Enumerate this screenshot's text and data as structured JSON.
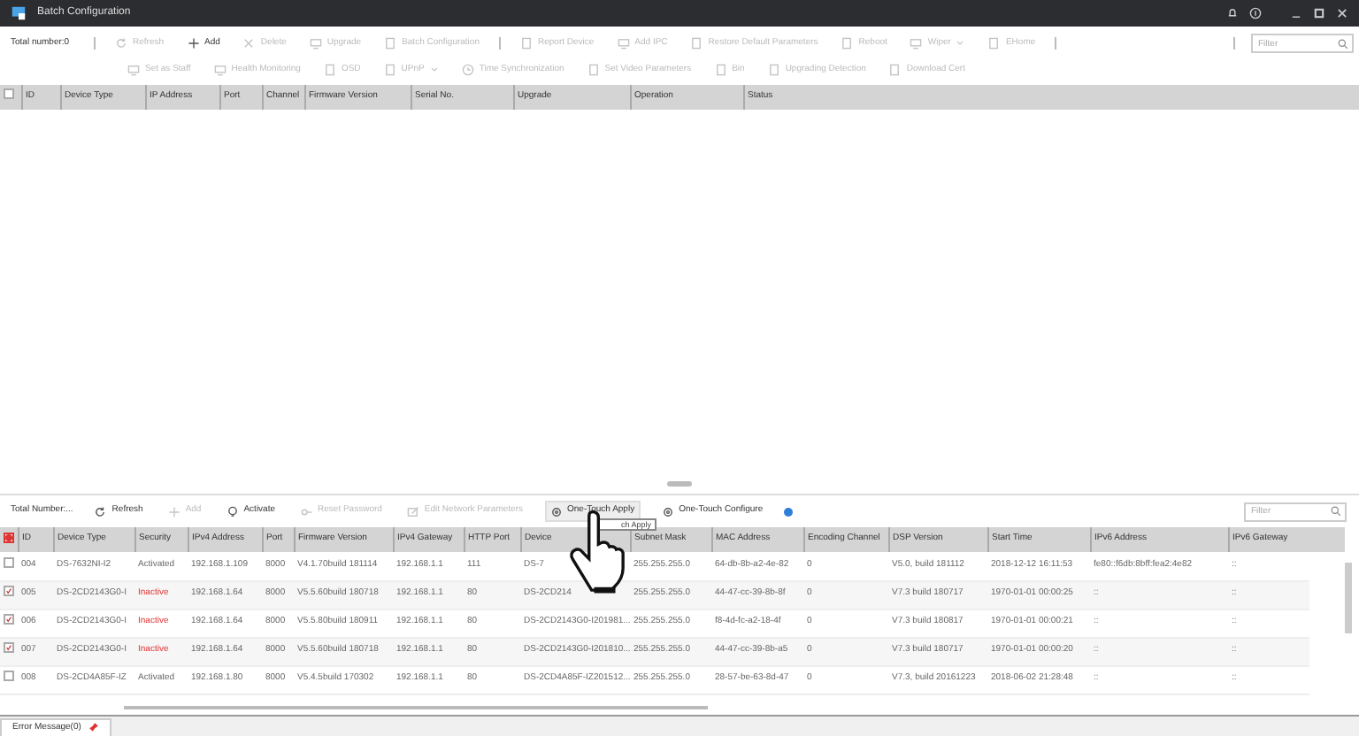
{
  "window": {
    "title": "Batch Configuration"
  },
  "top_panel": {
    "total": "Total number:0",
    "toolbar_rows": [
      [
        {
          "label": "Refresh",
          "disabled": true
        },
        {
          "label": "Add",
          "disabled": false
        },
        {
          "label": "Delete",
          "disabled": true
        },
        {
          "label": "Upgrade",
          "disabled": true
        },
        {
          "label": "Batch Configuration",
          "disabled": true
        },
        {
          "label": "Report Device",
          "disabled": true
        },
        {
          "label": "Add IPC",
          "disabled": true
        },
        {
          "label": "Restore Default Parameters",
          "disabled": true
        },
        {
          "label": "Reboot",
          "disabled": true
        },
        {
          "label": "Wiper",
          "disabled": true,
          "dropdown": true
        },
        {
          "label": "EHome",
          "disabled": true
        }
      ],
      [
        {
          "label": "Set as Staff",
          "disabled": true
        },
        {
          "label": "Health Monitoring",
          "disabled": true
        },
        {
          "label": "OSD",
          "disabled": true
        },
        {
          "label": "UPnP",
          "disabled": true,
          "dropdown": true
        },
        {
          "label": "Time Synchronization",
          "disabled": true
        },
        {
          "label": "Set Video Parameters",
          "disabled": true
        },
        {
          "label": "Bin",
          "disabled": true
        },
        {
          "label": "Upgrading Detection",
          "disabled": true
        },
        {
          "label": "Download Cert",
          "disabled": true
        }
      ]
    ],
    "filter": {
      "placeholder": "Filter"
    },
    "header_checkbox": {
      "checked": false
    },
    "columns": [
      "ID",
      "Device Type",
      "IP Address",
      "Port",
      "Channel",
      "Firmware Version",
      "Serial No.",
      "Upgrade",
      "Operation",
      "Status"
    ]
  },
  "bottom_panel": {
    "total": "Total Number:...",
    "toolbar": [
      {
        "label": "Refresh",
        "disabled": false,
        "hovered": false
      },
      {
        "label": "Add",
        "disabled": true,
        "hovered": false
      },
      {
        "label": "Activate",
        "disabled": false,
        "hovered": false
      },
      {
        "label": "Reset Password",
        "disabled": true,
        "hovered": false
      },
      {
        "label": "Edit Network Parameters",
        "disabled": true,
        "hovered": false
      },
      {
        "label": "One-Touch Apply",
        "disabled": false,
        "hovered": true
      },
      {
        "label": "One-Touch Configure",
        "disabled": false,
        "hovered": false
      }
    ],
    "tooltip": "ch Apply",
    "filter": {
      "placeholder": "Filter"
    },
    "header_checkbox": {
      "partial": true
    },
    "columns": [
      "ID",
      "Device Type",
      "Security",
      "IPv4 Address",
      "Port",
      "Firmware Version",
      "IPv4 Gateway",
      "HTTP Port",
      "Device",
      "Subnet Mask",
      "MAC Address",
      "Encoding Channel",
      "DSP Version",
      "Start Time",
      "IPv6 Address",
      "IPv6 Gateway"
    ],
    "rows": [
      {
        "checked": false,
        "security_alert": false,
        "cells": [
          "004",
          "DS-7632NI-I2",
          "Activated",
          "192.168.1.109",
          "8000",
          "V4.1.70build 181114",
          "192.168.1.1",
          "111",
          "DS-7",
          "255.255.255.0",
          "64-db-8b-a2-4e-82",
          "0",
          "V5.0, build 181112",
          "2018-12-12 16:11:53",
          "fe80::f6db:8bff:fea2:4e82",
          "::"
        ]
      },
      {
        "checked": true,
        "security_alert": true,
        "cells": [
          "005",
          "DS-2CD2143G0-I",
          "Inactive",
          "192.168.1.64",
          "8000",
          "V5.5.60build 180718",
          "192.168.1.1",
          "80",
          "DS-2CD214",
          "255.255.255.0",
          "44-47-cc-39-8b-8f",
          "0",
          "V7.3 build 180717",
          "1970-01-01 00:00:25",
          "::",
          "::"
        ]
      },
      {
        "checked": true,
        "security_alert": true,
        "cells": [
          "006",
          "DS-2CD2143G0-I",
          "Inactive",
          "192.168.1.64",
          "8000",
          "V5.5.80build 180911",
          "192.168.1.1",
          "80",
          "DS-2CD2143G0-I201981...",
          "255.255.255.0",
          "f8-4d-fc-a2-18-4f",
          "0",
          "V7.3 build 180817",
          "1970-01-01 00:00:21",
          "::",
          "::"
        ]
      },
      {
        "checked": true,
        "security_alert": true,
        "cells": [
          "007",
          "DS-2CD2143G0-I",
          "Inactive",
          "192.168.1.64",
          "8000",
          "V5.5.60build 180718",
          "192.168.1.1",
          "80",
          "DS-2CD2143G0-I201810...",
          "255.255.255.0",
          "44-47-cc-39-8b-a5",
          "0",
          "V7.3 build 180717",
          "1970-01-01 00:00:20",
          "::",
          "::"
        ]
      },
      {
        "checked": false,
        "security_alert": false,
        "cells": [
          "008",
          "DS-2CD4A85F-IZ",
          "Activated",
          "192.168.1.80",
          "8000",
          "V5.4.5build 170302",
          "192.168.1.1",
          "80",
          "DS-2CD4A85F-IZ201512...",
          "255.255.255.0",
          "28-57-be-63-8d-47",
          "0",
          "V7.3, build 20161223",
          "2018-06-02 21:28:48",
          "::",
          "::"
        ]
      }
    ]
  },
  "footer_tab": {
    "label": "Error Message(0)"
  }
}
